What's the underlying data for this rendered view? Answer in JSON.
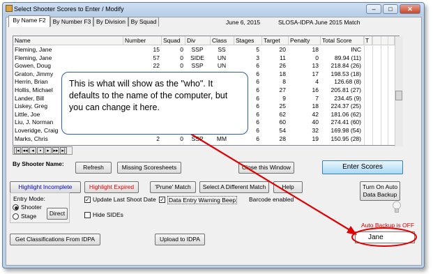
{
  "window": {
    "title": "Select Shooter Scores to Enter / Modify",
    "date": "June  6, 2015",
    "match_name": "SLOSA-IDPA June 2015 Match"
  },
  "tabs": [
    "By Name F2",
    "By Number F3",
    "By Division",
    "By Squad"
  ],
  "columns": [
    "Name",
    "Number",
    "Squad",
    "Div",
    "Class",
    "Stages",
    "Target",
    "Penalty",
    "Total Score",
    "T"
  ],
  "rows": [
    {
      "name": "Fleming, Jane",
      "number": "15",
      "squad": "0",
      "div": "SSP",
      "class": "SS",
      "stages": "5",
      "target": "20",
      "penalty": "18",
      "score": "INC"
    },
    {
      "name": "Fleming, Jane",
      "number": "57",
      "squad": "0",
      "div": "SIDE",
      "class": "UN",
      "stages": "3",
      "target": "11",
      "penalty": "0",
      "score": "89.94 (11)"
    },
    {
      "name": "Gowen, Doug",
      "number": "22",
      "squad": "0",
      "div": "SSP",
      "class": "UN",
      "stages": "6",
      "target": "26",
      "penalty": "13",
      "score": "218.84 (26)"
    },
    {
      "name": "Graton, Jimmy",
      "number": "",
      "squad": "",
      "div": "",
      "class": "",
      "stages": "6",
      "target": "18",
      "penalty": "17",
      "score": "198.53 (18)"
    },
    {
      "name": "Herrin, Brian",
      "number": "",
      "squad": "",
      "div": "",
      "class": "",
      "stages": "6",
      "target": "8",
      "penalty": "4",
      "score": "126.68 (8)"
    },
    {
      "name": "Hollis, Michael",
      "number": "",
      "squad": "",
      "div": "",
      "class": "",
      "stages": "6",
      "target": "27",
      "penalty": "16",
      "score": "205.81 (27)"
    },
    {
      "name": "Lander, Bill",
      "number": "",
      "squad": "",
      "div": "",
      "class": "",
      "stages": "6",
      "target": "9",
      "penalty": "7",
      "score": "234.45 (9)"
    },
    {
      "name": "Liskey, Greg",
      "number": "",
      "squad": "",
      "div": "",
      "class": "",
      "stages": "6",
      "target": "25",
      "penalty": "18",
      "score": "224.37 (25)"
    },
    {
      "name": "Little, Joe",
      "number": "",
      "squad": "",
      "div": "",
      "class": "",
      "stages": "6",
      "target": "62",
      "penalty": "42",
      "score": "181.06 (62)"
    },
    {
      "name": "Liu, J. Norman",
      "number": "",
      "squad": "",
      "div": "",
      "class": "",
      "stages": "6",
      "target": "60",
      "penalty": "40",
      "score": "274.41 (60)"
    },
    {
      "name": "Loveridge, Craig",
      "number": "",
      "squad": "",
      "div": "",
      "class": "",
      "stages": "6",
      "target": "54",
      "penalty": "32",
      "score": "169.98 (54)"
    },
    {
      "name": "Marks, Chris",
      "number": "2",
      "squad": "0",
      "div": "SSP",
      "class": "MM",
      "stages": "6",
      "target": "28",
      "penalty": "19",
      "score": "150.95 (28)"
    }
  ],
  "by_shooter_name_label": "By Shooter Name:",
  "buttons": {
    "refresh": "Refresh",
    "missing": "Missing Scoresheets",
    "close": "Close this Window",
    "enter": "Enter Scores",
    "highlight_incomplete": "Highlight Incomplete",
    "highlight_expired": "Highlight Expired",
    "prune": "'Prune' Match",
    "select_match": "Select A Different  Match",
    "help": "Help",
    "auto_backup": "Turn On Auto Data Backup",
    "direct": "Direct",
    "get_classifications": "Get Classifications From IDPA",
    "upload": "Upload to IDPA"
  },
  "entry_mode": {
    "label": "Entry Mode:",
    "options": [
      "Shooter",
      "Stage"
    ],
    "selected": "Shooter"
  },
  "checkboxes": {
    "update_last_shoot": {
      "label": "Update Last Shoot Date",
      "checked": true
    },
    "data_entry_warning": {
      "label": "Data Entry Warning Beep",
      "checked": true
    },
    "hide_sides": {
      "label": "Hide SIDEs",
      "checked": false
    }
  },
  "barcode_status": "Barcode enabled",
  "auto_backup_status": "Auto Backup is OFF",
  "who_field_value": "Jane",
  "callout_text": "This is what will show as the \"who\". It defaults to the name of the computer, but you can change it here.",
  "colors": {
    "annotation_red": "#e00000",
    "callout_border": "#2a5fa8",
    "window_frame": "#b9d1ea"
  }
}
